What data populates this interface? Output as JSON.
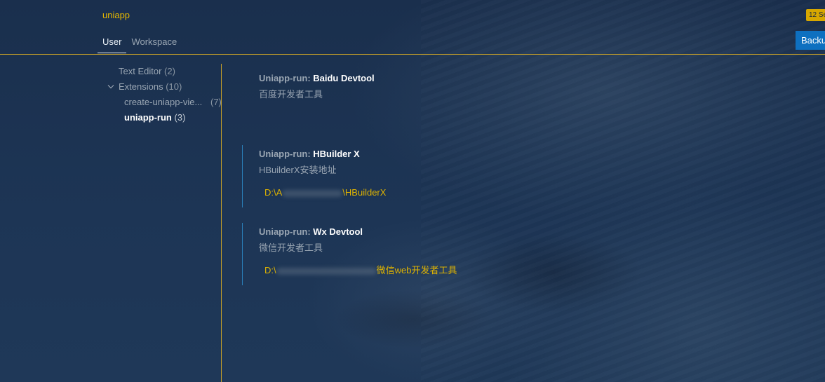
{
  "header": {
    "title": "uniapp",
    "badge": "12 Se",
    "tabs": [
      {
        "label": "User",
        "active": true
      },
      {
        "label": "Workspace",
        "active": false
      }
    ],
    "backup_button": "Backup"
  },
  "toc": {
    "items": [
      {
        "label": "Text Editor",
        "count": "(2)"
      },
      {
        "label": "Extensions",
        "count": "(10)",
        "expanded": true
      },
      {
        "label": "create-uniapp-vie...",
        "count": "(7)"
      },
      {
        "label": "uniapp-run",
        "count": "(3)",
        "selected": true
      }
    ]
  },
  "settings": [
    {
      "category": "Uniapp-run: ",
      "name": "Baidu Devtool",
      "description": "百度开发者工具",
      "value_prefix": "",
      "value_suffix": "",
      "modified": false
    },
    {
      "category": "Uniapp-run: ",
      "name": "HBuilder X",
      "description": "HBuilderX安装地址",
      "value_prefix": "D:\\A",
      "value_suffix": "\\HBuilderX",
      "modified": true
    },
    {
      "category": "Uniapp-run: ",
      "name": "Wx Devtool",
      "description": "微信开发者工具",
      "value_prefix": "D:\\",
      "value_suffix": "微信web开发者工具",
      "modified": true
    }
  ],
  "colors": {
    "accent": "#e5b800",
    "background": "#1b3150",
    "button": "#0e70c0",
    "modified_bar": "#2a7fb8"
  }
}
